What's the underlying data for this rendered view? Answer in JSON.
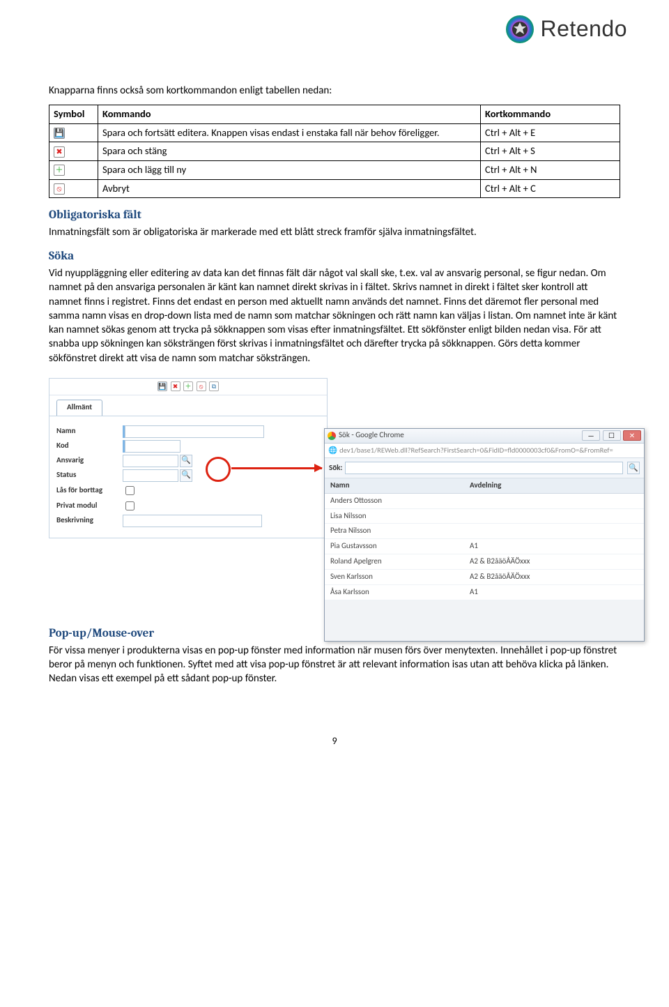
{
  "brand": {
    "name": "Retendo"
  },
  "intro": "Knapparna finns också som kortkommandon enligt tabellen nedan:",
  "table": {
    "headers": {
      "symbol": "Symbol",
      "command": "Kommando",
      "shortcut": "Kortkommando"
    },
    "rows": [
      {
        "command": "Spara och fortsätt editera. Knappen visas endast i enstaka fall när behov föreligger.",
        "shortcut": "Ctrl + Alt + E"
      },
      {
        "command": "Spara och stäng",
        "shortcut": "Ctrl + Alt + S"
      },
      {
        "command": "Spara och lägg till ny",
        "shortcut": "Ctrl + Alt + N"
      },
      {
        "command": "Avbryt",
        "shortcut": "Ctrl + Alt + C"
      }
    ]
  },
  "section_mandatory": {
    "title": "Obligatoriska fält",
    "body": "Inmatningsfält som är obligatoriska är markerade med ett blått streck framför själva inmatningsfältet."
  },
  "section_search": {
    "title": "Söka",
    "body": "Vid nyuppläggning eller editering av data kan det finnas fält där något val skall ske, t.ex. val av ansvarig personal, se figur nedan. Om namnet på den ansvariga personalen är känt kan namnet direkt skrivas in i fältet. Skrivs namnet in direkt i fältet sker kontroll att namnet finns i registret.  Finns det endast en person med aktuellt namn används det namnet. Finns det däremot fler personal med samma namn visas en drop-down lista med de namn som matchar sökningen och rätt namn kan väljas i listan. Om namnet inte är känt kan namnet sökas genom att trycka på sökknappen som visas efter inmatningsfältet. Ett sökfönster enligt bilden nedan visa. För att snabba upp sökningen kan söksträngen först skrivas  i inmatningsfältet och därefter trycka på sökknappen. Görs detta kommer sökfönstret direkt att visa de namn som matchar söksträngen."
  },
  "form": {
    "tab": "Allmänt",
    "labels": {
      "name": "Namn",
      "code": "Kod",
      "responsible": "Ansvarig",
      "status": "Status",
      "lockdel": "Lås för borttag",
      "privmod": "Privat modul",
      "desc": "Beskrivning"
    }
  },
  "chrome": {
    "title": "Sök - Google Chrome",
    "url": "dev1/base1/REWeb.dll?RefSearch?FirstSearch=0&FidID=fld0000003cf0&FromO=&FromRef=",
    "sok_label": "Sök:",
    "columns": {
      "name": "Namn",
      "dept": "Avdelning"
    },
    "rows": [
      {
        "name": "Anders Ottosson",
        "dept": ""
      },
      {
        "name": "Lisa Nilsson",
        "dept": ""
      },
      {
        "name": "Petra Nilsson",
        "dept": ""
      },
      {
        "name": "Pia Gustavsson",
        "dept": "A1"
      },
      {
        "name": "Roland Apelgren",
        "dept": "A2 & B2åäöÅÄÖxxx"
      },
      {
        "name": "Sven Karlsson",
        "dept": "A2 & B2åäöÅÄÖxxx"
      },
      {
        "name": "Åsa Karlsson",
        "dept": "A1"
      }
    ]
  },
  "section_popup": {
    "title": "Pop-up/Mouse-over",
    "body": "För vissa menyer i produkterna visas en pop-up fönster med information när musen förs över menytexten. Innehållet i pop-up fönstret beror på menyn och funktionen. Syftet med att visa pop-up fönstret är att relevant information isas utan att behöva klicka på länken. Nedan visas ett exempel på ett sådant pop-up fönster."
  },
  "page_num": "9"
}
